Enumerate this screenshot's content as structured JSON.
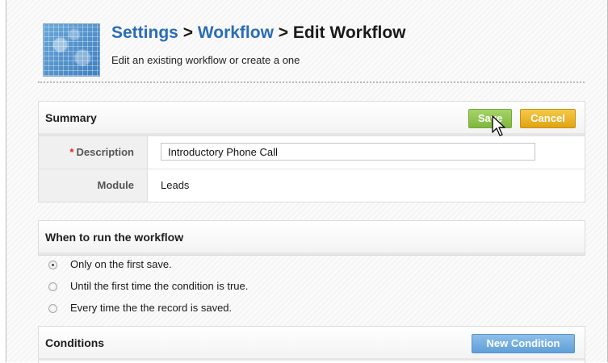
{
  "header": {
    "breadcrumb": [
      "Settings",
      "Workflow",
      "Edit Workflow"
    ],
    "separator": ">",
    "subtitle": "Edit an existing workflow or create a one"
  },
  "summary": {
    "title": "Summary",
    "save_label": "Save",
    "cancel_label": "Cancel",
    "description_label": "Description",
    "required_marker": "*",
    "description_value": "Introductory Phone Call",
    "module_label": "Module",
    "module_value": "Leads"
  },
  "when_to_run": {
    "title": "When to run the workflow",
    "options": [
      {
        "label": "Only on the first save.",
        "selected": true
      },
      {
        "label": "Until the first time the condition is true.",
        "selected": false
      },
      {
        "label": "Every time the the record is saved.",
        "selected": false
      }
    ]
  },
  "conditions": {
    "title": "Conditions",
    "new_condition_label": "New Condition"
  },
  "colors": {
    "link": "#2a6db5",
    "save": "#8bc34a",
    "cancel": "#e8b021",
    "new_condition": "#6aa8de"
  }
}
